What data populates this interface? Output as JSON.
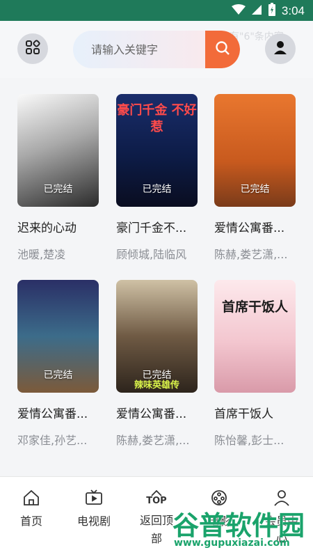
{
  "status_bar": {
    "time": "3:04"
  },
  "header": {
    "search_placeholder": "请输入关键字",
    "ghost_text": "有\"6\"条内容"
  },
  "dramas": [
    {
      "title": "迟来的心动",
      "cast": "池暖,楚凌",
      "status": "已完结",
      "poster_text": ""
    },
    {
      "title": "豪门千金不...",
      "cast": "顾倾城,陆临风",
      "status": "已完结",
      "poster_text": "豪门千金 不好惹"
    },
    {
      "title": "爱情公寓番...",
      "cast": "陈赫,娄艺潇,...",
      "status": "已完结",
      "poster_text": ""
    },
    {
      "title": "爱情公寓番...",
      "cast": "邓家佳,孙艺...",
      "status": "已完结",
      "poster_text": ""
    },
    {
      "title": "爱情公寓番...",
      "cast": "陈赫,娄艺潇,...",
      "status": "已完结",
      "poster_text": "辣味英雄传"
    },
    {
      "title": "首席干饭人",
      "cast": "陈怡馨,彭士...",
      "status": "",
      "poster_text": "首席干饭人"
    }
  ],
  "nav": {
    "home": "首页",
    "tv": "电视剧",
    "top_icon": "TOP",
    "back_top": "返回顶部",
    "movie": "电影",
    "member": "会员中心"
  },
  "watermark": {
    "cn": "谷普软件园",
    "url": "www.gupuxiazai.com"
  }
}
